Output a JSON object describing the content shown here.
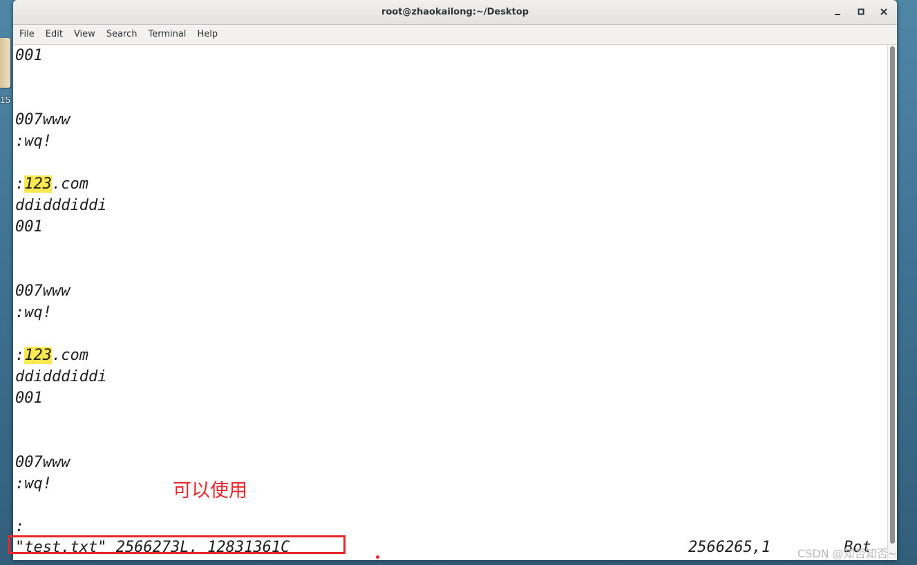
{
  "window": {
    "title": "root@zhaokailong:~/Desktop"
  },
  "desktop": {
    "icon_label": "15"
  },
  "window_controls": {
    "minimize": "–",
    "maximize": "□",
    "close": "✕"
  },
  "menubar": {
    "items": [
      "File",
      "Edit",
      "View",
      "Search",
      "Terminal",
      "Help"
    ]
  },
  "terminal": {
    "lines": [
      {
        "pre": "001",
        "hl": "",
        "post": ""
      },
      {
        "pre": "",
        "hl": "",
        "post": ""
      },
      {
        "pre": "",
        "hl": "",
        "post": ""
      },
      {
        "pre": "007www",
        "hl": "",
        "post": ""
      },
      {
        "pre": ":wq!",
        "hl": "",
        "post": ""
      },
      {
        "pre": "",
        "hl": "",
        "post": ""
      },
      {
        "pre": ":",
        "hl": "123",
        "post": ".com"
      },
      {
        "pre": "ddidddiddi",
        "hl": "",
        "post": ""
      },
      {
        "pre": "001",
        "hl": "",
        "post": ""
      },
      {
        "pre": "",
        "hl": "",
        "post": ""
      },
      {
        "pre": "",
        "hl": "",
        "post": ""
      },
      {
        "pre": "007www",
        "hl": "",
        "post": ""
      },
      {
        "pre": ":wq!",
        "hl": "",
        "post": ""
      },
      {
        "pre": "",
        "hl": "",
        "post": ""
      },
      {
        "pre": ":",
        "hl": "123",
        "post": ".com"
      },
      {
        "pre": "ddidddiddi",
        "hl": "",
        "post": ""
      },
      {
        "pre": "001",
        "hl": "",
        "post": ""
      },
      {
        "pre": "",
        "hl": "",
        "post": ""
      },
      {
        "pre": "",
        "hl": "",
        "post": ""
      },
      {
        "pre": "007www",
        "hl": "",
        "post": ""
      },
      {
        "pre": ":wq!",
        "hl": "",
        "post": ""
      },
      {
        "pre": "",
        "hl": "",
        "post": ""
      },
      {
        "pre": ":",
        "hl": "",
        "post": ""
      }
    ],
    "status_file": "\"test.txt\" 2566273L, 12831361C",
    "status_position": "2566265,1",
    "status_scroll": "Bot"
  },
  "annotation": {
    "text": "可以使用"
  },
  "watermark": {
    "text": "CSDN @知否知否~"
  },
  "colors": {
    "search_highlight": "#fce94f",
    "annotation_red": "#e8272d"
  }
}
